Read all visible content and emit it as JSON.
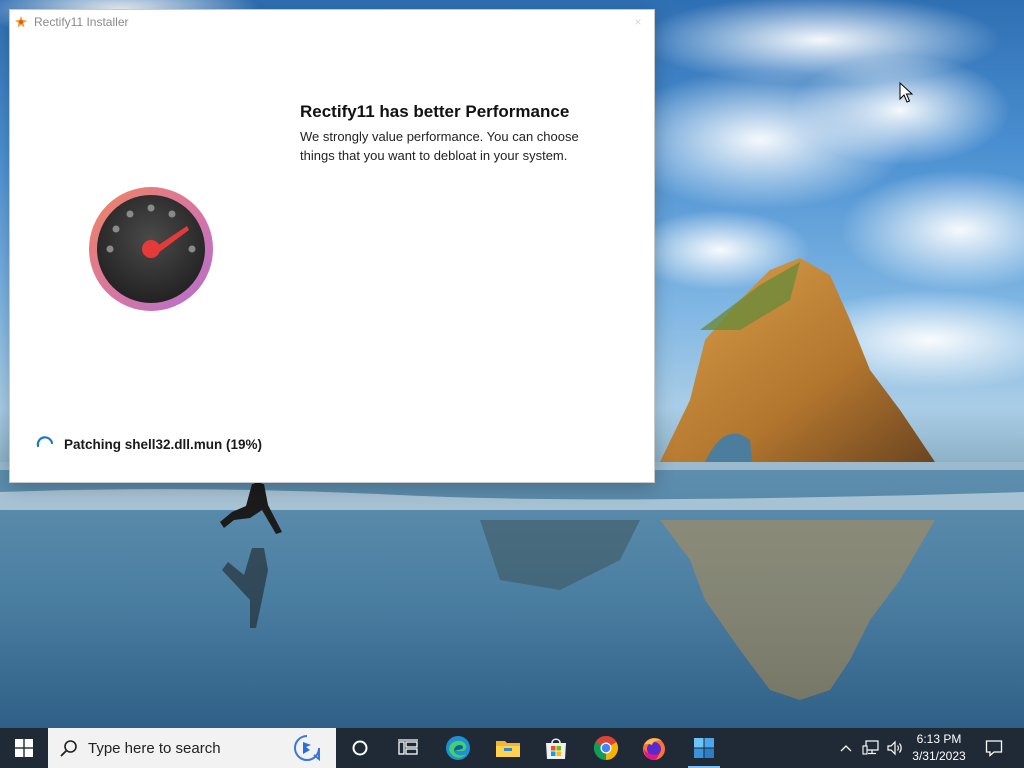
{
  "window": {
    "title": "Rectify11 Installer",
    "close_label": "×",
    "icon": "rectify11-logo-icon"
  },
  "content": {
    "heading": "Rectify11 has better Performance",
    "description": "We strongly value performance. You can choose things that you want to debloat in your system.",
    "illustration_icon": "speedometer-icon"
  },
  "status": {
    "text": "Patching shell32.dll.mun (19%)",
    "progress_percent": 19,
    "icon": "loading-spinner-icon"
  },
  "taskbar": {
    "search_placeholder": "Type here to search",
    "pinned": [
      "windows-start-icon",
      "search-icon",
      "bing-icon",
      "cortana-circle-icon",
      "task-view-icon",
      "edge-icon",
      "file-explorer-icon",
      "microsoft-store-icon",
      "chrome-icon",
      "firefox-icon",
      "rectify11-installer-icon"
    ],
    "tray_icons": [
      "chevron-up-icon",
      "network-icon",
      "volume-icon"
    ],
    "time": "6:13 PM",
    "date": "3/31/2023",
    "notification_icon": "notification-icon"
  },
  "colors": {
    "taskbar": "#1f2a36",
    "accent": "#7cc0f5",
    "gauge_ring_start": "#f0855c",
    "gauge_ring_end": "#b16fd0",
    "gauge_needle": "#e53a3a"
  }
}
